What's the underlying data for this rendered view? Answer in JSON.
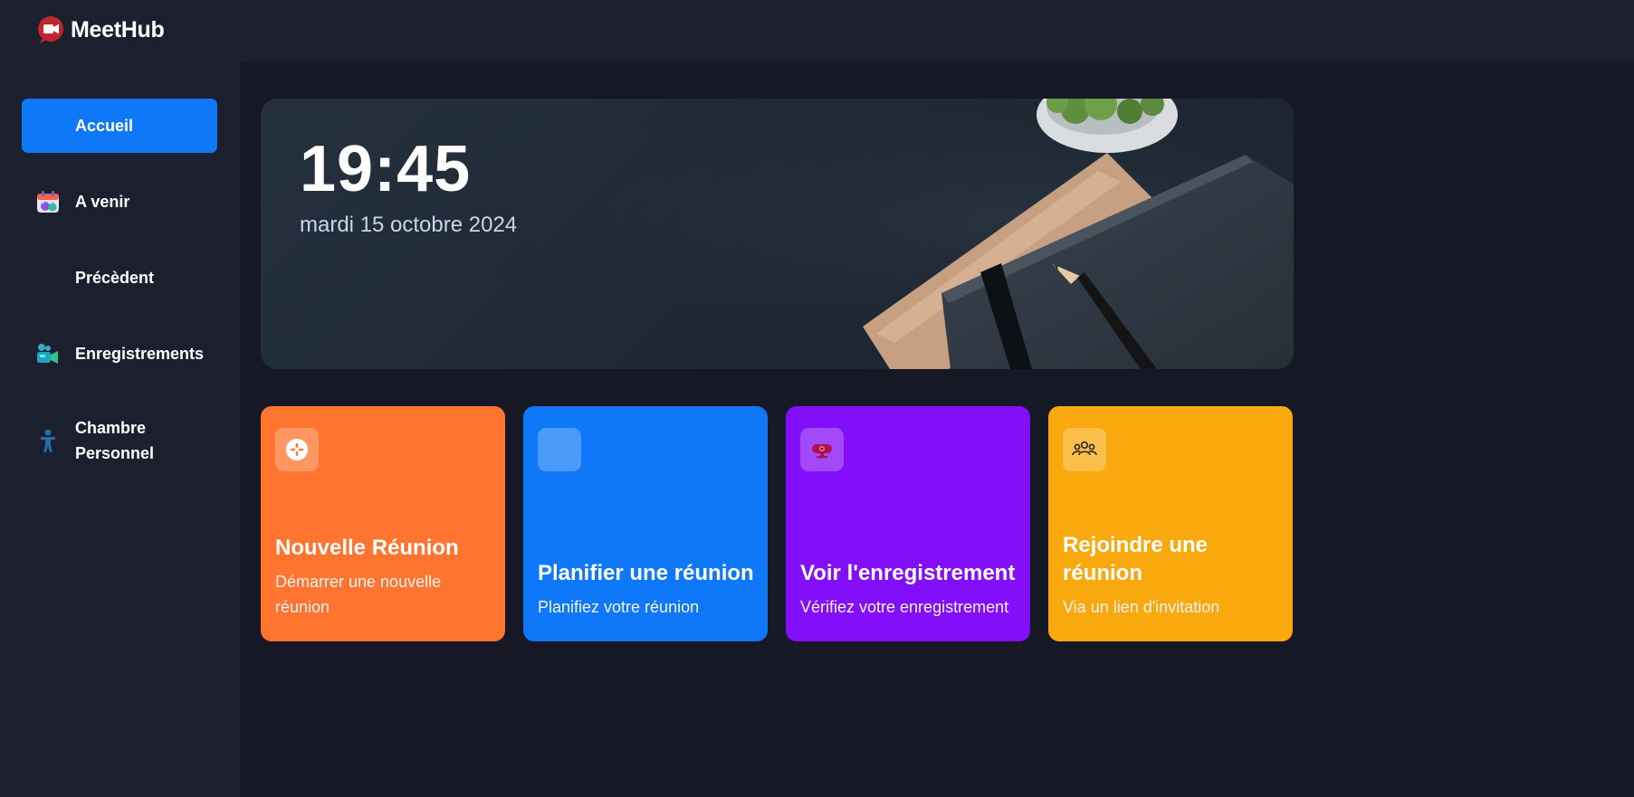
{
  "app": {
    "name": "MeetHub",
    "accent_color": "#0e78f9"
  },
  "sidebar": {
    "items": [
      {
        "label": "Accueil",
        "icon": "home-icon",
        "active": true
      },
      {
        "label": "A venir",
        "icon": "calendar-icon",
        "active": false
      },
      {
        "label": "Précèdent",
        "icon": "history-icon",
        "active": false
      },
      {
        "label": "Enregistrements",
        "icon": "video-recording-icon",
        "active": false
      },
      {
        "label": "Chambre Personnel",
        "icon": "person-icon",
        "active": false
      }
    ]
  },
  "hero": {
    "time": "19:45",
    "date": "mardi 15 octobre 2024"
  },
  "cards": [
    {
      "title": "Nouvelle Réunion",
      "description": "Démarrer une nouvelle réunion",
      "icon": "add-meeting-icon",
      "color": "#ff742e"
    },
    {
      "title": "Planifier une réunion",
      "description": "Planifiez votre réunion",
      "icon": "calendar-schedule-icon",
      "color": "#0e78f9"
    },
    {
      "title": "Voir l'enregistrement",
      "description": "Vérifiez votre enregistrement",
      "icon": "webcam-icon",
      "color": "#830ef9"
    },
    {
      "title": "Rejoindre une réunion",
      "description": "Via un lien d'invitation",
      "icon": "people-group-icon",
      "color": "#f9a90e"
    }
  ]
}
